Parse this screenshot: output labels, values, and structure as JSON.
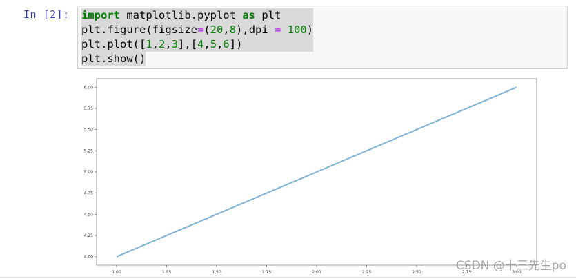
{
  "cell": {
    "prompt": "In  [2]:",
    "code_lines": [
      [
        {
          "t": "import",
          "c": "kw"
        },
        {
          "t": " matplotlib.pyplot "
        },
        {
          "t": "as",
          "c": "kw"
        },
        {
          "t": " plt"
        }
      ],
      [
        {
          "t": "plt.figure(figsize"
        },
        {
          "t": "=",
          "c": "op"
        },
        {
          "t": "("
        },
        {
          "t": "20",
          "c": "num"
        },
        {
          "t": ","
        },
        {
          "t": "8",
          "c": "num"
        },
        {
          "t": "),dpi "
        },
        {
          "t": "=",
          "c": "op"
        },
        {
          "t": " "
        },
        {
          "t": "100",
          "c": "num"
        },
        {
          "t": ")"
        }
      ],
      [
        {
          "t": "plt.plot(["
        },
        {
          "t": "1",
          "c": "num"
        },
        {
          "t": ","
        },
        {
          "t": "2",
          "c": "num"
        },
        {
          "t": ","
        },
        {
          "t": "3",
          "c": "num"
        },
        {
          "t": "],["
        },
        {
          "t": "4",
          "c": "num"
        },
        {
          "t": ","
        },
        {
          "t": "5",
          "c": "num"
        },
        {
          "t": ","
        },
        {
          "t": "6",
          "c": "num"
        },
        {
          "t": "])"
        }
      ],
      [
        {
          "t": "plt.show()"
        }
      ]
    ]
  },
  "colors": {
    "prompt": "#303f9f",
    "keyword": "#008000",
    "operator": "#aa22ff",
    "line": "#7fb3d5"
  },
  "chart_data": {
    "type": "line",
    "x": [
      1,
      2,
      3
    ],
    "series": [
      {
        "values": [
          4,
          5,
          6
        ]
      }
    ],
    "xlim": [
      0.9,
      3.1
    ],
    "ylim": [
      3.9,
      6.1
    ],
    "xticks": [
      "1.00",
      "1.25",
      "1.50",
      "1.75",
      "2.00",
      "2.25",
      "2.50",
      "2.75",
      "3.00"
    ],
    "yticks": [
      "4.00",
      "4.25",
      "4.50",
      "4.75",
      "5.00",
      "5.25",
      "5.50",
      "5.75",
      "6.00"
    ],
    "grid": false
  },
  "watermark": "CSDN @十三先生po"
}
